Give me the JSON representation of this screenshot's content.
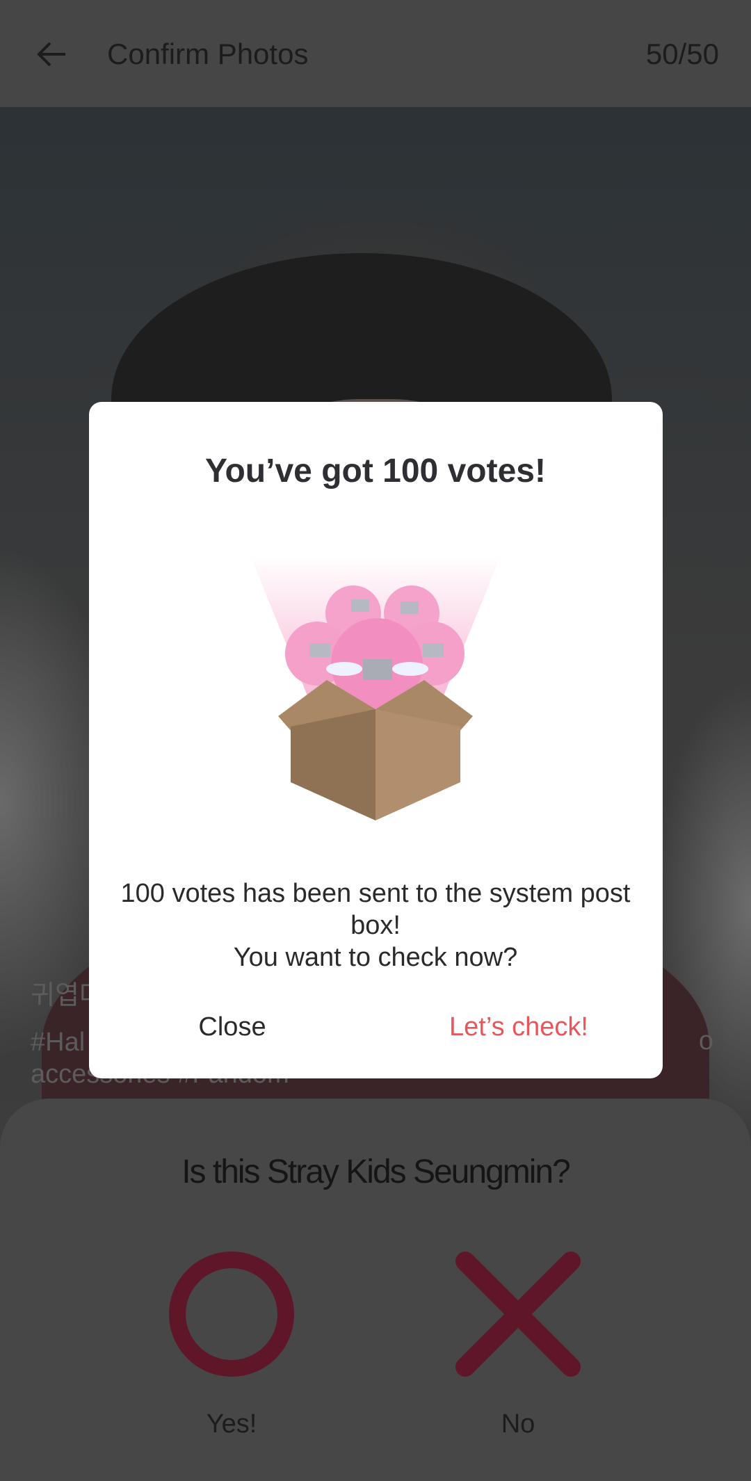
{
  "appbar": {
    "title": "Confirm Photos",
    "count": "50/50"
  },
  "photo": {
    "caption_line1": "귀엽다",
    "caption_line2": "#Hal",
    "caption_line3": "accessories #Fandom",
    "caption_tail": "o"
  },
  "sheet": {
    "question": "Is this Stray Kids Seungmin?",
    "yes_label": "Yes!",
    "no_label": "No",
    "yes_color": "#6a1a2a",
    "no_color": "#6a1a2a"
  },
  "dialog": {
    "title": "You’ve got 100 votes!",
    "message_line1": "100 votes has been sent to the system post box!",
    "message_line2": "You want to check now?",
    "close_label": "Close",
    "check_label": "Let’s check!",
    "accent_color": "#e8565c",
    "illustration": "vote-box-with-flying-ballots"
  }
}
